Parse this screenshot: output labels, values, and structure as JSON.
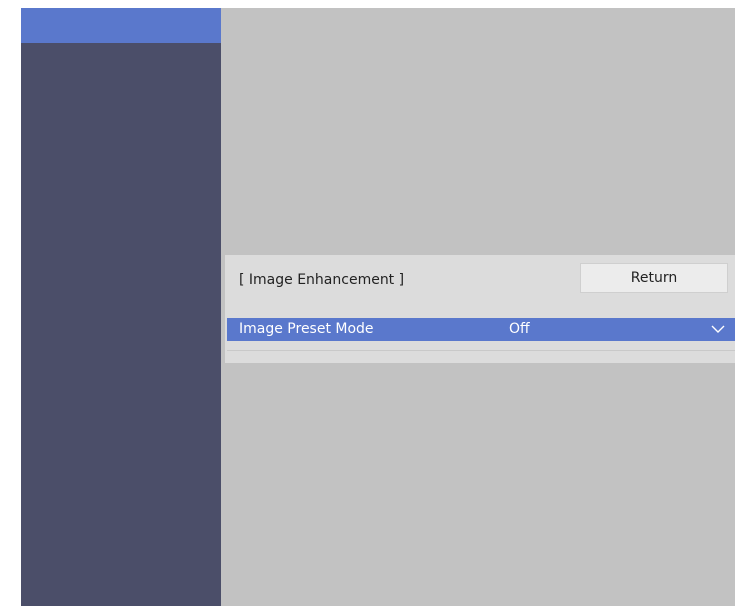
{
  "panel": {
    "title": "[ Image Enhancement ]",
    "return_label": "Return"
  },
  "option": {
    "label": "Image Preset Mode",
    "value": "Off",
    "expand_icon": "chevron-down-icon"
  },
  "colors": {
    "sidebar": "#4b4e69",
    "sidebar_selected": "#5a78cc",
    "background": "#c2c2c2",
    "panel": "#dcdcdc",
    "highlight": "#5a78cc"
  }
}
